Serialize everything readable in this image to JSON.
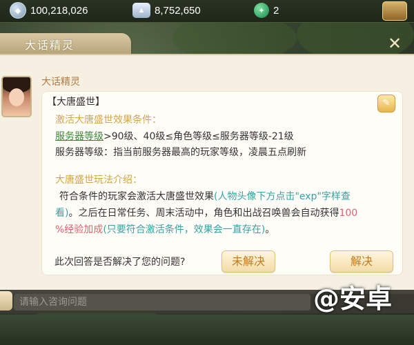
{
  "topbar": {
    "coins": "100,218,026",
    "silver": "8,752,650",
    "jade": "2"
  },
  "panel": {
    "title": "大话精灵",
    "speaker": "大话精灵"
  },
  "message": {
    "heading": "【大唐盛世】",
    "cond_title": "激活大唐盛世效果条件：",
    "cond_line1_link": "服务器等级",
    "cond_line1_rest": ">90级、40级≤角色等级≤服务器等级-21级",
    "cond_line2": "服务器等级：指当前服务器最高的玩家等级，凌晨五点刷新",
    "play_title": "大唐盛世玩法介绍：",
    "play_line1_a": "符合条件的玩家会激活大唐盛世效果",
    "play_line1_b": "(人物头像下方点击\"exp\"字样查",
    "play_line2_a": "看)",
    "play_line2_b": "。之后在日常任务、周末活动中，角色和出战召唤兽会自动获得",
    "play_line2_c": "100",
    "play_line3_a": "%经验加成",
    "play_line3_b": "(只要符合激活条件，效果会一直存在)",
    "play_line3_c": "。"
  },
  "feedback": {
    "question": "此次回答是否解决了您的问题?",
    "no_label": "未解决",
    "yes_label": "解决"
  },
  "input": {
    "placeholder": "请输入咨询问题"
  },
  "watermark": "@安卓"
}
